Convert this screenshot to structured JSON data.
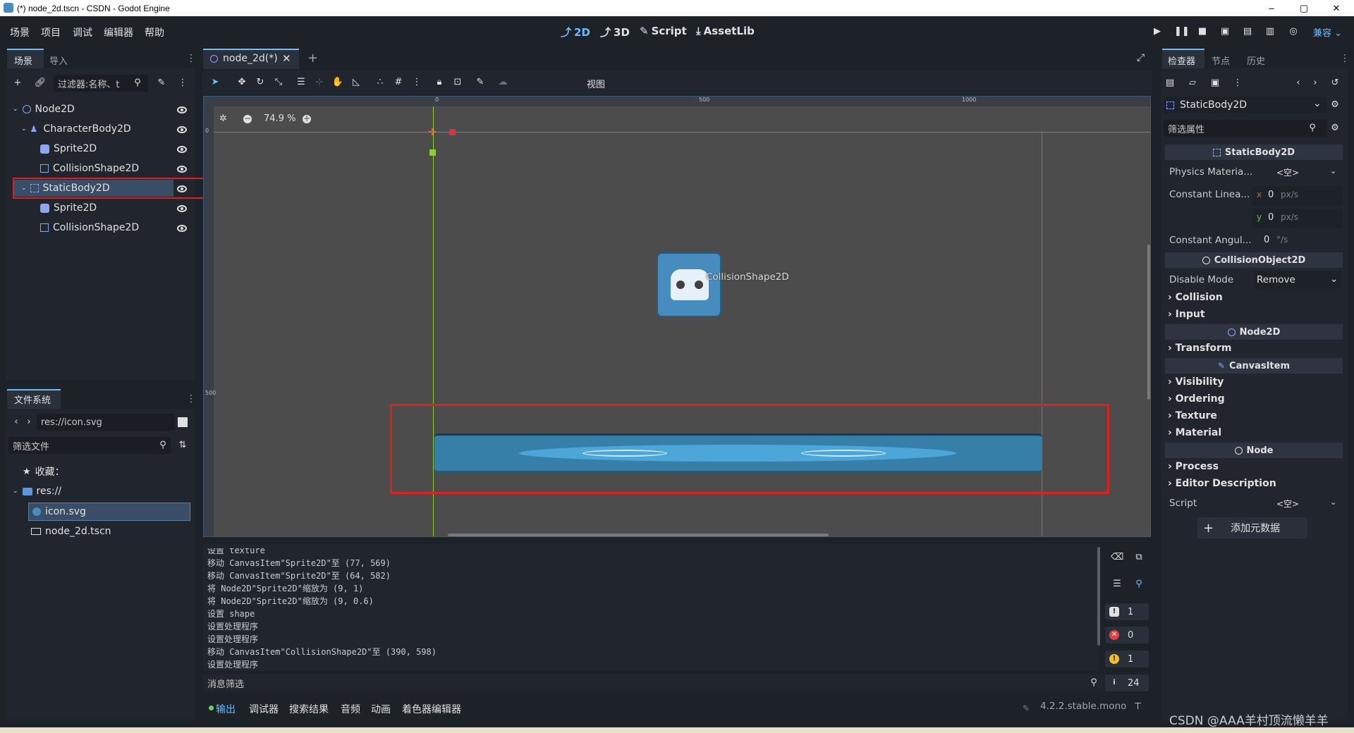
{
  "window": {
    "title": "(*) node_2d.tscn - CSDN - Godot Engine",
    "controls": [
      "–",
      "▢",
      "✕"
    ]
  },
  "menu": {
    "items": [
      "场景",
      "项目",
      "调试",
      "编辑器",
      "帮助"
    ]
  },
  "modes": {
    "m2d": "2D",
    "m3d": "3D",
    "script": "Script",
    "assetlib": "AssetLib"
  },
  "renderer": "兼容",
  "scene_dock": {
    "tabs": [
      "场景",
      "导入"
    ],
    "filter_placeholder": "过滤器:名称、t",
    "tree": [
      {
        "label": "Node2D",
        "icon": "node2d-icon"
      },
      {
        "label": "CharacterBody2D",
        "icon": "character-body-icon"
      },
      {
        "label": "Sprite2D",
        "icon": "sprite-icon"
      },
      {
        "label": "CollisionShape2D",
        "icon": "collision-shape-icon"
      },
      {
        "label": "StaticBody2D",
        "icon": "static-body-icon"
      },
      {
        "label": "Sprite2D",
        "icon": "sprite-icon"
      },
      {
        "label": "CollisionShape2D",
        "icon": "collision-shape-icon"
      }
    ]
  },
  "fs_dock": {
    "title": "文件系统",
    "path": "res://icon.svg",
    "filter_placeholder": "筛选文件",
    "items": [
      {
        "label": "收藏：",
        "icon": "star-icon"
      },
      {
        "label": "res://",
        "icon": "folder-icon"
      },
      {
        "label": "icon.svg",
        "icon": "svg-file-icon"
      },
      {
        "label": "node_2d.tscn",
        "icon": "scene-file-icon"
      }
    ]
  },
  "editor": {
    "tab_label": "node_2d(*)",
    "view_label": "视图",
    "zoom": "74.9 %",
    "ruler": [
      "0",
      "500",
      "1000"
    ],
    "vruler": [
      "0",
      "500"
    ],
    "collision_label": "CollisionShape2D"
  },
  "output": {
    "lines": [
      "设置 texture",
      "移动 CanvasItem\"Sprite2D\"至 (77, 569)",
      "移动 CanvasItem\"Sprite2D\"至 (64, 582)",
      "将 Node2D\"Sprite2D\"缩放为 (9, 1)",
      "将 Node2D\"Sprite2D\"缩放为 (9, 0.6)",
      "设置 shape",
      "设置处理程序",
      "设置处理程序",
      "移动 CanvasItem\"CollisionShape2D\"至 (390, 598)",
      "设置处理程序"
    ],
    "filter_placeholder": "消息筛选",
    "counts": {
      "info": "1",
      "errors": "0",
      "warnings": "1",
      "total": "24"
    }
  },
  "bottom_tabs": [
    "输出",
    "调试器",
    "搜索结果",
    "音频",
    "动画",
    "着色器编辑器"
  ],
  "version": "4.2.2.stable.mono",
  "watermark": "CSDN @AAA羊村顶流懒羊羊",
  "inspector": {
    "tabs": [
      "检查器",
      "节点",
      "历史"
    ],
    "node_name": "StaticBody2D",
    "filter_placeholder": "筛选属性",
    "sections": {
      "static_body": "StaticBody2D",
      "collision_object": "CollisionObject2D",
      "node2d": "Node2D",
      "canvas_item": "CanvasItem",
      "node": "Node"
    },
    "props": {
      "physics_material": "Physics Materia...",
      "physics_material_val": "<空>",
      "const_linear": "Constant Linea...",
      "lin_x_label": "x",
      "lin_x": "0",
      "lin_y_label": "y",
      "lin_y": "0",
      "unit_px": "px/s",
      "const_angular": "Constant Angul...",
      "ang_val": "0",
      "unit_deg": "°/s",
      "disable_mode": "Disable Mode",
      "disable_mode_val": "Remove",
      "script": "Script",
      "script_val": "<空>",
      "add_meta": "添加元数据"
    },
    "groups": {
      "collision": "Collision",
      "input": "Input",
      "transform": "Transform",
      "visibility": "Visibility",
      "ordering": "Ordering",
      "texture": "Texture",
      "material": "Material",
      "process": "Process",
      "editor_desc": "Editor Description"
    }
  },
  "colors": {
    "accent": "#70bafa",
    "selection": "#3a4d66",
    "highlight_red": "#e02020",
    "sprite_blue": "#478cbf",
    "node_blue": "#8da5f3"
  }
}
